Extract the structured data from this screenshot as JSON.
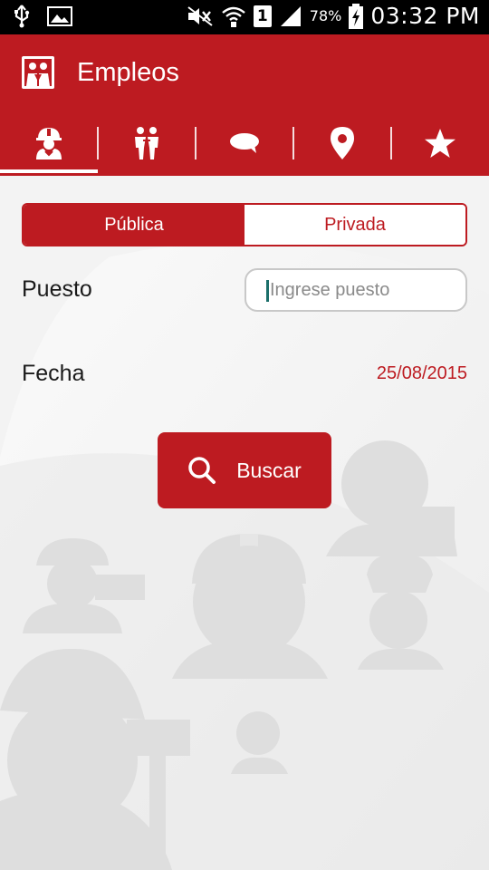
{
  "status_bar": {
    "battery_percent": "78%",
    "sim_slot": "1",
    "time": "03:32 PM",
    "icons": [
      "usb-icon",
      "image-icon",
      "mute-icon",
      "wifi-icon",
      "sim-icon",
      "signal-icon",
      "battery-charging-icon"
    ]
  },
  "app_bar": {
    "title": "Empleos",
    "logo_icon": "app-logo-icon"
  },
  "tabs": [
    {
      "icon": "worker-icon",
      "active": true
    },
    {
      "icon": "people-icon",
      "active": false
    },
    {
      "icon": "chat-icon",
      "active": false
    },
    {
      "icon": "location-icon",
      "active": false
    },
    {
      "icon": "star-icon",
      "active": false
    }
  ],
  "sector_toggle": {
    "options": [
      "Pública",
      "Privada"
    ],
    "selected": "Pública"
  },
  "form": {
    "puesto_label": "Puesto",
    "puesto_placeholder": "Ingrese puesto",
    "fecha_label": "Fecha",
    "fecha_value": "25/08/2015"
  },
  "search_button": {
    "label": "Buscar",
    "icon": "search-icon"
  },
  "colors": {
    "primary": "#bd1b21",
    "background": "#f1f1f1"
  }
}
